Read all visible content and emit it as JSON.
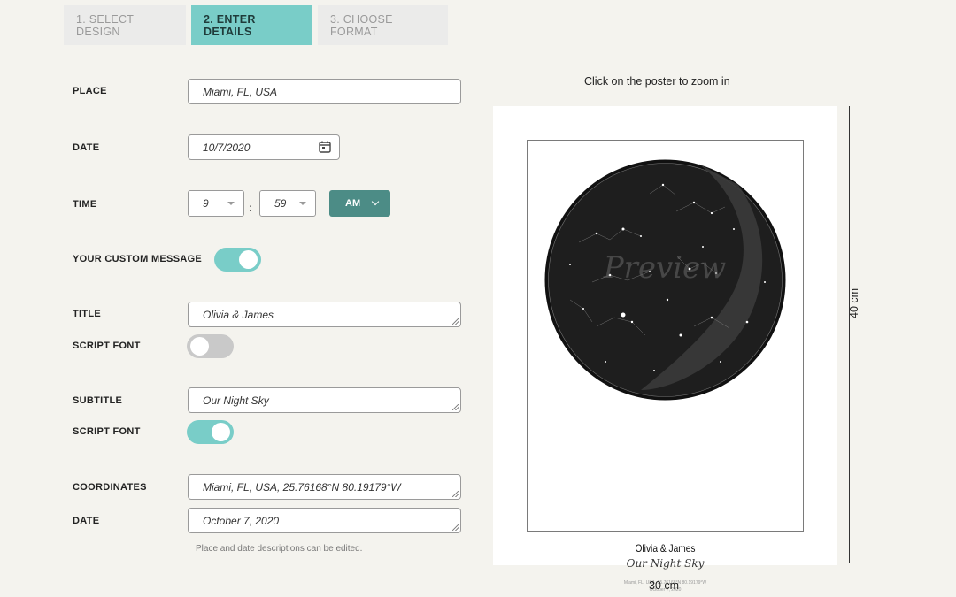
{
  "tabs": [
    {
      "label": "1. SELECT DESIGN"
    },
    {
      "label": "2. ENTER DETAILS"
    },
    {
      "label": "3. CHOOSE FORMAT"
    }
  ],
  "form": {
    "place_label": "PLACE",
    "place_value": "Miami, FL, USA",
    "date_label": "DATE",
    "date_value": "10/7/2020",
    "time_label": "TIME",
    "hour": "9",
    "minute": "59",
    "colon": ":",
    "ampm": "AM",
    "custom_message_label": "YOUR CUSTOM MESSAGE",
    "title_label": "TITLE",
    "title_value": "Olivia & James",
    "script_font_label": "SCRIPT FONT",
    "subtitle_label": "SUBTITLE",
    "subtitle_value": "Our Night Sky",
    "coordinates_label": "COORDINATES",
    "coordinates_value": "Miami, FL, USA, 25.76168°N 80.19179°W",
    "date_desc_label": "DATE",
    "date_desc_value": "October 7, 2020",
    "note": "Place and date descriptions can be edited."
  },
  "toggles": {
    "custom_message": true,
    "title_script_font": false,
    "subtitle_script_font": true
  },
  "preview": {
    "zoom_hint": "Click on the poster to zoom in",
    "watermark": "Preview",
    "poster_title": "Olivia & James",
    "poster_subtitle": "Our Night Sky",
    "poster_coords": "Miami, FL, USA, 25.76168°N 80.19179°W",
    "poster_date": "October 7, 2020",
    "height_label": "40 cm",
    "width_label": "30 cm"
  },
  "colors": {
    "accent": "#79cdc8",
    "accent_dark": "#4c8c86",
    "background": "#f4f3ee",
    "sky": "#1b1b1b"
  }
}
